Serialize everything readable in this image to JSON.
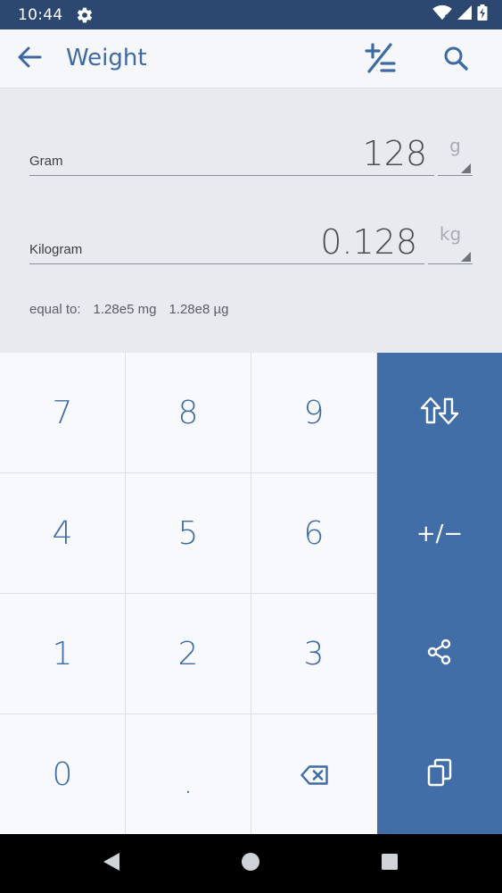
{
  "status_bar": {
    "time": "10:44",
    "icons": [
      "gear-icon",
      "wifi-icon",
      "signal-icon",
      "battery-icon"
    ]
  },
  "app_bar": {
    "title": "Weight",
    "back_icon": "arrow-left-icon",
    "action_icons": [
      "plus-minus-icon",
      "search-icon"
    ]
  },
  "conversion": {
    "from": {
      "label": "Gram",
      "value": "128",
      "unit": "g"
    },
    "to": {
      "label": "Kilogram",
      "value": "0.128",
      "unit": "kg"
    },
    "equal_label": "equal to:",
    "equivalents": [
      "1.28e5 mg",
      "1.28e8 µg"
    ]
  },
  "keypad": {
    "keys": [
      "7",
      "8",
      "9",
      "4",
      "5",
      "6",
      "1",
      "2",
      "3",
      "0",
      "."
    ],
    "backspace_icon": "backspace-icon",
    "side_keys": {
      "swap_icon": "swap-arrows-icon",
      "sign_label": "+/−",
      "share_icon": "share-icon",
      "copy_icon": "copy-icon"
    }
  },
  "colors": {
    "status_bar": "#2c4870",
    "accent": "#3e6aa3",
    "side_panel": "#426ea8",
    "display_bg": "#e8eaef",
    "key_bg": "#f7f9fc"
  }
}
